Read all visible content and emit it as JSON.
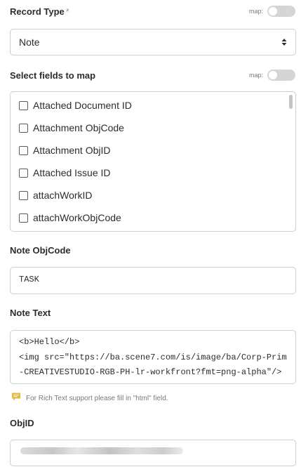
{
  "record_type": {
    "label": "Record Type",
    "required_mark": "*",
    "map_label": "map:",
    "map_enabled": false,
    "selected_value": "Note"
  },
  "select_fields": {
    "label": "Select fields to map",
    "map_label": "map:",
    "map_enabled": false,
    "items": [
      {
        "label": "Attached Document ID",
        "checked": false
      },
      {
        "label": "Attachment ObjCode",
        "checked": false
      },
      {
        "label": "Attachment ObjID",
        "checked": false
      },
      {
        "label": "Attached Issue ID",
        "checked": false
      },
      {
        "label": "attachWorkID",
        "checked": false
      },
      {
        "label": "attachWorkObjCode",
        "checked": false
      }
    ]
  },
  "note_objcode": {
    "label": "Note ObjCode",
    "value": "TASK"
  },
  "note_text": {
    "label": "Note Text",
    "lines": [
      "<b>Hello</b>",
      "<img src=\"https://ba.scene7.com/is/image/ba/Corp-Prim",
      "-CREATIVESTUDIO-RGB-PH-lr-workfront?fmt=png-alpha\"/>"
    ]
  },
  "hint": {
    "icon": "comment-icon",
    "text": "For Rich Text support please fill in \"html\" field."
  },
  "objid": {
    "label": "ObjID"
  },
  "colors": {
    "border": "#cfcfcf",
    "toggle_off": "#d5d5d5",
    "hint_icon": "#e8b83a",
    "label": "#2c2c2c"
  }
}
